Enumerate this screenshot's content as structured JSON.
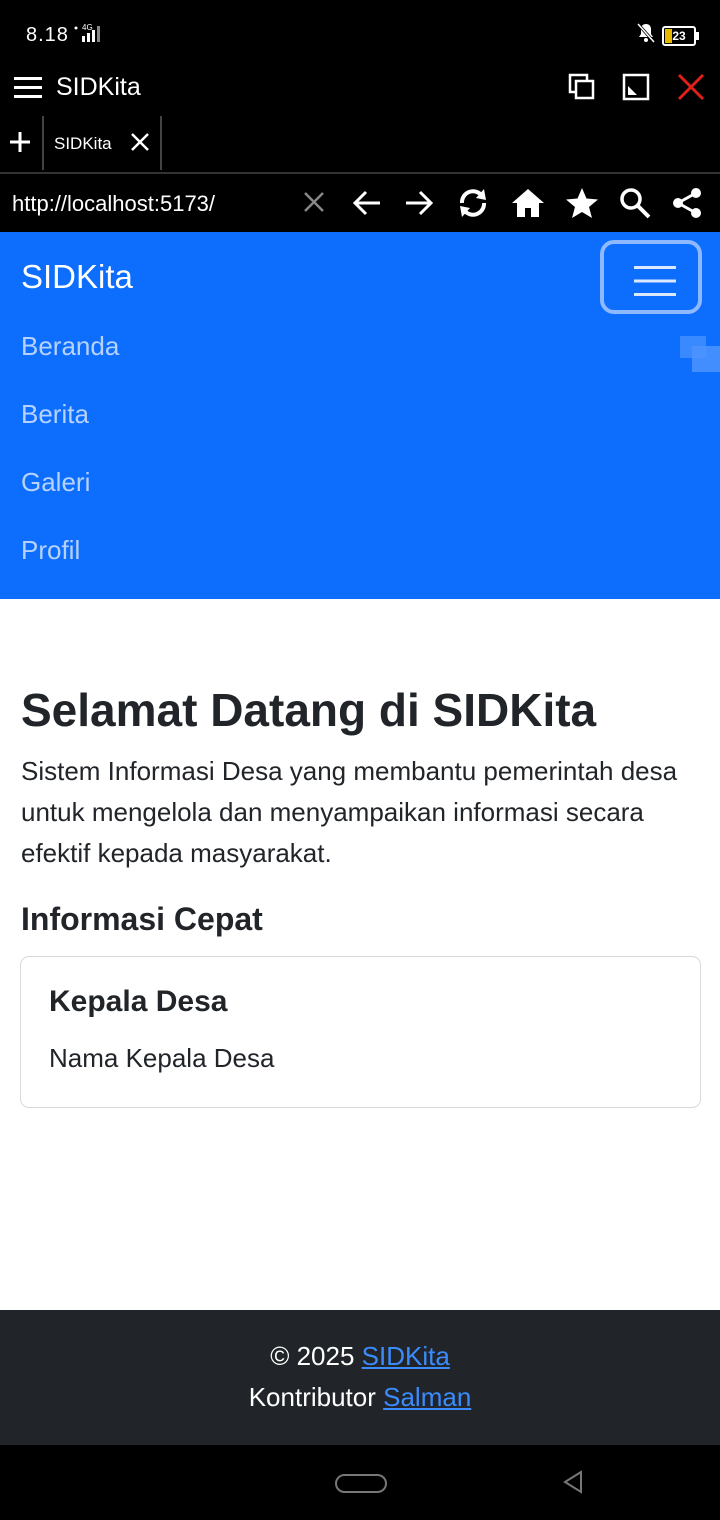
{
  "status": {
    "time": "8.18",
    "network": "4G",
    "battery": "23"
  },
  "appbar": {
    "title": "SIDKita"
  },
  "tabs": [
    {
      "label": "SIDKita"
    }
  ],
  "urlbar": {
    "url": "http://localhost:5173/"
  },
  "site": {
    "brand": "SIDKita",
    "nav": [
      {
        "label": "Beranda"
      },
      {
        "label": "Berita"
      },
      {
        "label": "Galeri"
      },
      {
        "label": "Profil"
      }
    ]
  },
  "hero": {
    "title": "Selamat Datang di SIDKita",
    "text": "Sistem Informasi Desa yang membantu pemerintah desa untuk mengelola dan menyampaikan informasi secara efektif kepada masyarakat."
  },
  "info": {
    "title": "Informasi Cepat",
    "card": {
      "title": "Kepala Desa",
      "text": "Nama Kepala Desa"
    }
  },
  "footer": {
    "copyright": "© 2025",
    "brand_link": "SIDKita",
    "contributor_label": "Kontributor",
    "contributor_link": "Salman"
  },
  "colors": {
    "navbar": "#0d6efd",
    "footer": "#212529",
    "link": "#3b8bfd",
    "close_icon": "#e0201b"
  }
}
